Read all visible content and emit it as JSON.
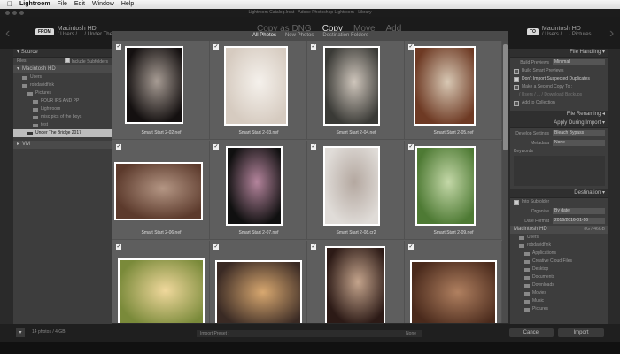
{
  "menubar": {
    "apple": "",
    "app": "Lightroom",
    "items": [
      "File",
      "Edit",
      "Window",
      "Help"
    ]
  },
  "window": {
    "title": "Lightroom Catalog.lrcat - Adobe Photoshop Lightroom - Library"
  },
  "topbar": {
    "from_badge": "FROM",
    "from_title": "Macintosh HD",
    "from_path": "/ Users / ... / Under The Bridge 2017",
    "modes": [
      "Copy as DNG",
      "Copy",
      "Move",
      "Add"
    ],
    "to_badge": "TO",
    "to_title": "Macintosh HD",
    "to_path": "/ Users / ... / Pictures"
  },
  "source": {
    "header": "Source",
    "files_label": "Files",
    "include_subfolders": "Include Subfolders",
    "drive": "Macintosh HD",
    "tree": [
      {
        "label": "Users",
        "level": 1
      },
      {
        "label": "robdavidfink",
        "level": 1
      },
      {
        "label": "Pictures",
        "level": 2
      },
      {
        "label": "FOUR IPS AND PP",
        "level": 3
      },
      {
        "label": "Lightroom",
        "level": 3
      },
      {
        "label": "misc pics of the boys",
        "level": 3
      },
      {
        "label": "test",
        "level": 3
      },
      {
        "label": "Under The Bridge 2017",
        "level": 2,
        "selected": true
      }
    ],
    "vm": "VM"
  },
  "grid": {
    "tabs": [
      "All Photos",
      "New Photos",
      "Destination Folders"
    ],
    "photos": [
      {
        "name": "Smart Start 2-02.nef",
        "colors": [
          "#141010",
          "#a79c94"
        ]
      },
      {
        "name": "Smart Start 2-03.nef",
        "colors": [
          "#d6cbc0",
          "#f5f1ec"
        ]
      },
      {
        "name": "Smart Start 2-04.nef",
        "colors": [
          "#3a3a36",
          "#cfc6bc"
        ]
      },
      {
        "name": "Smart Start 2-05.nef",
        "colors": [
          "#6e3a24",
          "#d8c8b4"
        ]
      },
      {
        "name": "Smart Start 2-06.nef",
        "colors": [
          "#5c3a2c",
          "#b49684"
        ]
      },
      {
        "name": "Smart Start 2-07.nef",
        "colors": [
          "#101010",
          "#b4849c"
        ]
      },
      {
        "name": "Smart Start 2-08.cr2",
        "colors": [
          "#e0dcd8",
          "#b4a8a0"
        ]
      },
      {
        "name": "Smart Start 2-09.nef",
        "colors": [
          "#4e7a34",
          "#c4d8a8"
        ]
      },
      {
        "name": "",
        "colors": [
          "#7a8a3a",
          "#f0d89c"
        ]
      },
      {
        "name": "",
        "colors": [
          "#3a2a24",
          "#d8a870"
        ]
      },
      {
        "name": "",
        "colors": [
          "#2c1a16",
          "#c4a48c"
        ]
      },
      {
        "name": "",
        "colors": [
          "#4a2a1c",
          "#b08060"
        ]
      }
    ]
  },
  "file_handling": {
    "header": "File Handling",
    "build_previews_label": "Build Previews",
    "build_previews_value": "Minimal",
    "smart_previews": "Build Smart Previews",
    "dont_import": "Don't Import Suspected Duplicates",
    "second_copy": "Make a Second Copy To :",
    "second_copy_path": "/ Users / ... / Download Backups",
    "add_collection": "Add to Collection"
  },
  "file_renaming": {
    "header": "File Renaming"
  },
  "apply": {
    "header": "Apply During Import",
    "develop_label": "Develop Settings",
    "develop_value": "Bleach Bypass",
    "metadata_label": "Metadata",
    "metadata_value": "None",
    "keywords_label": "Keywords"
  },
  "destination": {
    "header": "Destination",
    "into_subfolder": "Into Subfolder",
    "organize_label": "Organize",
    "organize_value": "By date",
    "date_format_label": "Date Format",
    "date_format_value": "2016/2016-01-16",
    "drive": "Macintosh HD",
    "drive_space": "8G / 46GB",
    "folders": [
      {
        "label": "Users",
        "level": 1
      },
      {
        "label": "robdavidfink",
        "level": 1
      },
      {
        "label": "Applications",
        "level": 2
      },
      {
        "label": "Creative Cloud Files",
        "level": 2
      },
      {
        "label": "Desktop",
        "level": 2
      },
      {
        "label": "Documents",
        "level": 2
      },
      {
        "label": "Downloads",
        "level": 2
      },
      {
        "label": "Movies",
        "level": 2
      },
      {
        "label": "Music",
        "level": 2
      },
      {
        "label": "Pictures",
        "level": 2
      }
    ]
  },
  "bottom": {
    "count": "14 photos / 4 GB",
    "preset_label": "Import Preset :",
    "preset_value": "None",
    "cancel": "Cancel",
    "import": "Import"
  },
  "colors": {
    "panel": "#3d3d3d",
    "grid": "#5e5e5e",
    "background": "#2a2a2a"
  }
}
